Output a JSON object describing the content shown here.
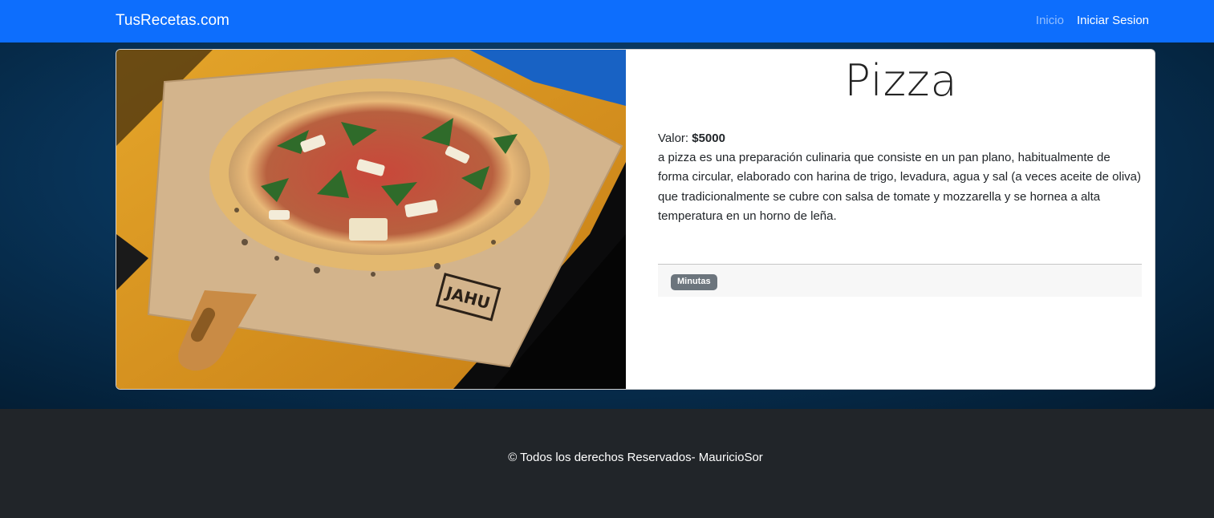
{
  "navbar": {
    "brand": "TusRecetas.com",
    "links": [
      {
        "label": "Inicio"
      },
      {
        "label": "Iniciar Sesion"
      }
    ],
    "color": "#0d6efd"
  },
  "recipe": {
    "title": "Pizza",
    "price_label": "Valor:",
    "price_value": "$5000",
    "description": "a pizza es una preparación culinaria que consiste en un pan plano, habitualmente de forma circular, elaborado con harina de trigo, levadura, agua y sal (a veces aceite de oliva) que tradicionalmente se cubre con salsa de tomate y mozzarella y se hornea a alta temperatura en un horno de leña.",
    "badge": "Minutas",
    "image_icon": "pizza-photo",
    "board_stamp": "JAHU"
  },
  "footer": {
    "text": "© Todos los derechos Reservados- MauricioSor"
  }
}
